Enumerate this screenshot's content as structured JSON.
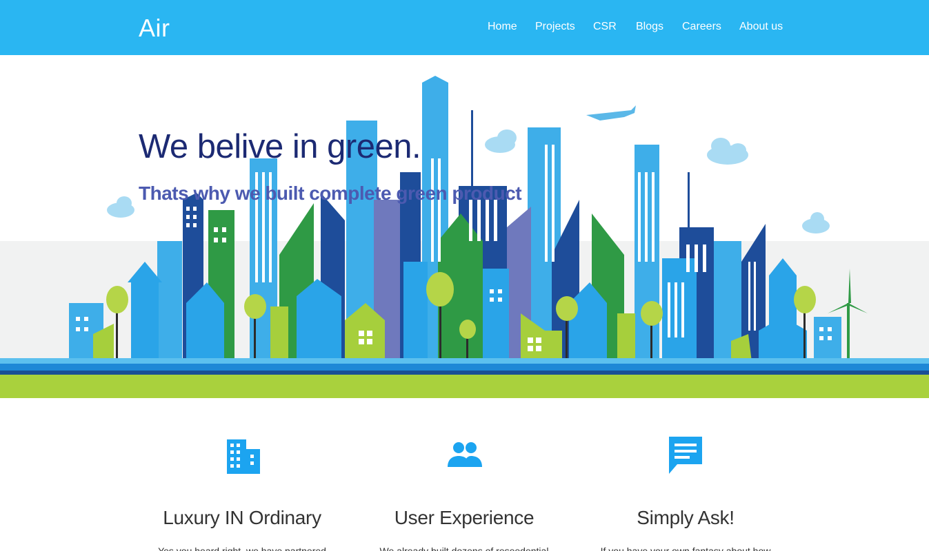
{
  "brand": {
    "name": "Air"
  },
  "nav": {
    "items": [
      {
        "label": "Home"
      },
      {
        "label": "Projects"
      },
      {
        "label": "CSR"
      },
      {
        "label": "Blogs"
      },
      {
        "label": "Careers"
      },
      {
        "label": "About us"
      }
    ]
  },
  "hero": {
    "title": "We belive in green.",
    "subtitle": "Thats why we built complete green product"
  },
  "features": [
    {
      "icon": "building-icon",
      "title": "Luxury IN Ordinary",
      "text": "Yes you heard right, we have partnered"
    },
    {
      "icon": "users-icon",
      "title": "User Experience",
      "text": "We already built dozens of reseedential"
    },
    {
      "icon": "chat-icon",
      "title": "Simply Ask!",
      "text": "If you have your own fantasy about how"
    }
  ],
  "colors": {
    "navbar": "#2ab6f2",
    "hero_title": "#1c2a73",
    "hero_subtitle": "#4c5ab0",
    "icon": "#1ca4f0",
    "ground_green": "#a9d13d"
  }
}
